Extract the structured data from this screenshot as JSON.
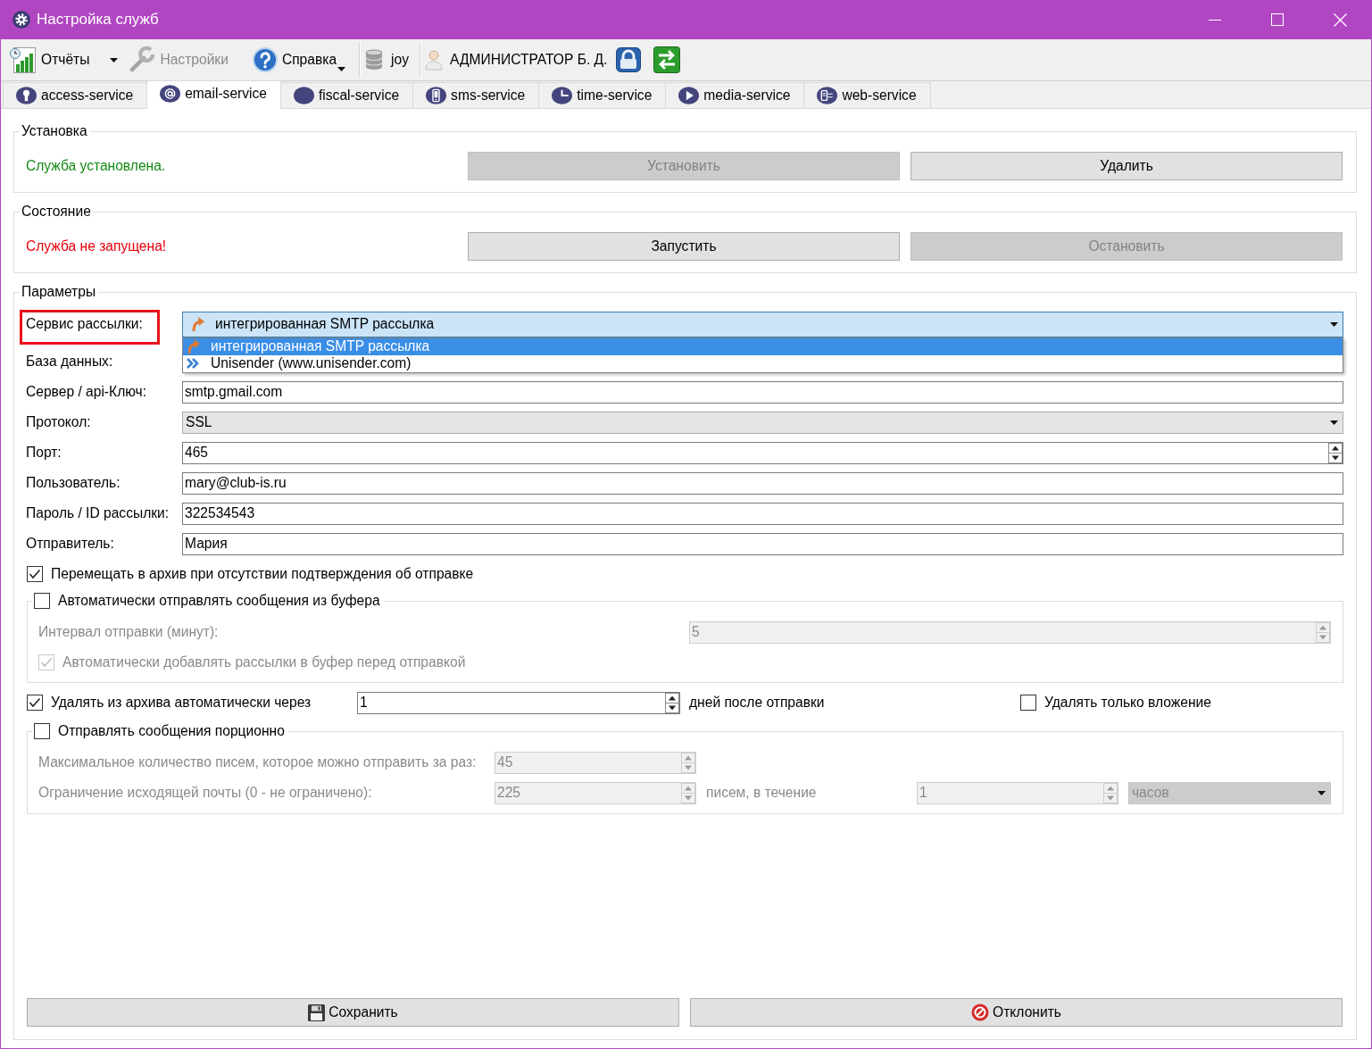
{
  "window": {
    "title": "Настройка служб"
  },
  "toolbar": {
    "groups": [
      {
        "items": [
          {
            "kind": "split",
            "label": "Отчёты",
            "disabled": false
          },
          {
            "kind": "button",
            "label": "Настройки",
            "disabled": true
          },
          {
            "kind": "menu",
            "label": "Справка",
            "disabled": false
          }
        ]
      },
      {
        "items": [
          {
            "kind": "label",
            "label": "joy",
            "disabled": false
          }
        ]
      },
      {
        "items": [
          {
            "kind": "label",
            "label": "АДМИНИСТРАТОР Б. Д.",
            "disabled": false
          },
          {
            "kind": "icon",
            "disabled": false
          },
          {
            "kind": "icon",
            "disabled": false
          }
        ]
      }
    ]
  },
  "tabs": [
    {
      "label": "access-service",
      "selected": false
    },
    {
      "label": "email-service",
      "selected": true
    },
    {
      "label": "fiscal-service",
      "selected": false
    },
    {
      "label": "sms-service",
      "selected": false
    },
    {
      "label": "time-service",
      "selected": false
    },
    {
      "label": "media-service",
      "selected": false
    },
    {
      "label": "web-service",
      "selected": false
    }
  ],
  "sections": [
    {
      "title": "Установка",
      "status": {
        "text": "Служба установлена.",
        "kind": "ok"
      },
      "buttons": [
        {
          "label": "Установить",
          "disabled": true
        },
        {
          "label": "Удалить",
          "disabled": false
        }
      ]
    },
    {
      "title": "Состояние",
      "status": {
        "text": "Служба не запущена!",
        "kind": "error"
      },
      "buttons": [
        {
          "label": "Запустить",
          "disabled": false
        },
        {
          "label": "Остановить",
          "disabled": true
        }
      ]
    }
  ],
  "parameters": {
    "title": "Параметры",
    "fields": [
      {
        "kind": "combo",
        "label": "Сервис рассылки:",
        "value": "интегрированная SMTP рассылка",
        "highlighted": true,
        "open": true,
        "options": [
          {
            "label": "интегрированная SMTP рассылка",
            "selected": true
          },
          {
            "label": "Unisender (www.unisender.com)",
            "selected": false
          }
        ]
      },
      {
        "kind": "covered",
        "label": "База данных:",
        "highlighted": false
      },
      {
        "kind": "text",
        "label": "Сервер / api-Ключ:",
        "value": "smtp.gmail.com",
        "highlighted": false
      },
      {
        "kind": "combo",
        "label": "Протокол:",
        "value": "SSL",
        "highlighted": false,
        "open": false
      },
      {
        "kind": "spin",
        "label": "Порт:",
        "value": "465",
        "highlighted": false
      },
      {
        "kind": "text",
        "label": "Пользователь:",
        "value": "mary@club-is.ru",
        "highlighted": false
      },
      {
        "kind": "text",
        "label": "Пароль / ID рассылки:",
        "value": "322534543",
        "highlighted": false
      },
      {
        "kind": "text",
        "label": "Отправитель:",
        "value": "Мария",
        "highlighted": false
      }
    ],
    "move_to_archive": {
      "label": "Перемещать в архив при отсутствии подтверждения об отправке",
      "checked": true
    },
    "buffer_group": {
      "label": "Автоматически отправлять сообщения из буфера",
      "checked": false,
      "interval": {
        "label": "Интервал отправки (минут):",
        "value": "5"
      },
      "add_to_buffer": {
        "label": "Автоматически добавлять рассылки в буфер перед отправкой",
        "checked": true
      }
    },
    "auto_delete": {
      "label": "Удалять из архива автоматически через",
      "checked": true,
      "value": "1",
      "unit": "дней после отправки",
      "attachments_only": {
        "label": "Удалять только вложение",
        "checked": false
      }
    },
    "batch_group": {
      "label": "Отправлять сообщения порционно",
      "checked": false,
      "max_per_send": {
        "label": "Максимальное количество писем, которое можно отправить за раз:",
        "value": "45"
      },
      "outgoing_limit": {
        "label": "Ограничение исходящей почты (0 - не ограничено):",
        "value": "225",
        "per_label": "писем, в течение",
        "period_value": "1",
        "period_unit": "часов"
      }
    },
    "actions": [
      {
        "label": "Сохранить"
      },
      {
        "label": "Отклонить"
      }
    ]
  }
}
